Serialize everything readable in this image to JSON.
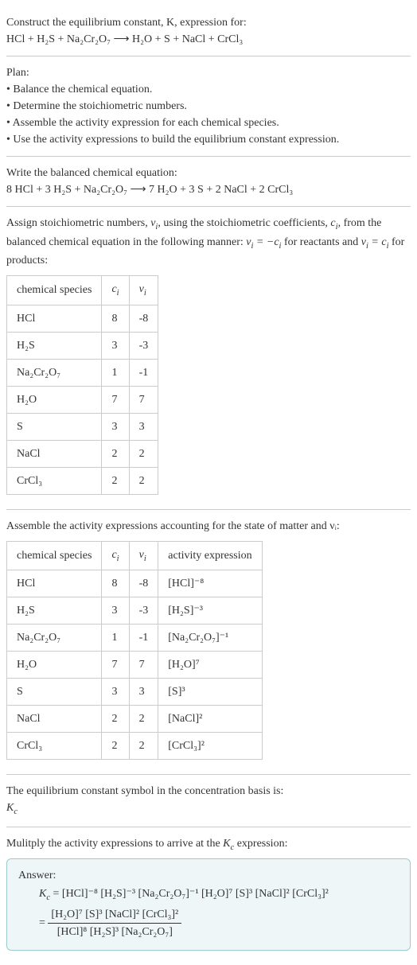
{
  "s1": {
    "l1": "Construct the equilibrium constant, K, expression for:",
    "l2": "HCl + H₂S + Na₂Cr₂O₇ ⟶ H₂O + S + NaCl + CrCl₃"
  },
  "s2": {
    "h": "Plan:",
    "b1": "• Balance the chemical equation.",
    "b2": "• Determine the stoichiometric numbers.",
    "b3": "• Assemble the activity expression for each chemical species.",
    "b4": "• Use the activity expressions to build the equilibrium constant expression."
  },
  "s3": {
    "l1": "Write the balanced chemical equation:",
    "l2": "8 HCl + 3 H₂S + Na₂Cr₂O₇ ⟶ 7 H₂O + 3 S + 2 NaCl + 2 CrCl₃"
  },
  "s4": {
    "p1a": "Assign stoichiometric numbers, ",
    "p1b": ", using the stoichiometric coefficients, ",
    "p1c": ", from the balanced chemical equation in the following manner: ",
    "p1d": " for reactants and ",
    "p1e": " for products:",
    "th1": "chemical species",
    "th2": "cᵢ",
    "th3": "νᵢ",
    "rows": [
      {
        "sp": "HCl",
        "c": "8",
        "v": "-8"
      },
      {
        "sp": "H₂S",
        "c": "3",
        "v": "-3"
      },
      {
        "sp": "Na₂Cr₂O₇",
        "c": "1",
        "v": "-1"
      },
      {
        "sp": "H₂O",
        "c": "7",
        "v": "7"
      },
      {
        "sp": "S",
        "c": "3",
        "v": "3"
      },
      {
        "sp": "NaCl",
        "c": "2",
        "v": "2"
      },
      {
        "sp": "CrCl₃",
        "c": "2",
        "v": "2"
      }
    ]
  },
  "s5": {
    "p1": "Assemble the activity expressions accounting for the state of matter and νᵢ:",
    "th1": "chemical species",
    "th2": "cᵢ",
    "th3": "νᵢ",
    "th4": "activity expression",
    "rows": [
      {
        "sp": "HCl",
        "c": "8",
        "v": "-8",
        "a": "[HCl]⁻⁸"
      },
      {
        "sp": "H₂S",
        "c": "3",
        "v": "-3",
        "a": "[H₂S]⁻³"
      },
      {
        "sp": "Na₂Cr₂O₇",
        "c": "1",
        "v": "-1",
        "a": "[Na₂Cr₂O₇]⁻¹"
      },
      {
        "sp": "H₂O",
        "c": "7",
        "v": "7",
        "a": "[H₂O]⁷"
      },
      {
        "sp": "S",
        "c": "3",
        "v": "3",
        "a": "[S]³"
      },
      {
        "sp": "NaCl",
        "c": "2",
        "v": "2",
        "a": "[NaCl]²"
      },
      {
        "sp": "CrCl₃",
        "c": "2",
        "v": "2",
        "a": "[CrCl₃]²"
      }
    ]
  },
  "s6": {
    "l1": "The equilibrium constant symbol in the concentration basis is:",
    "l2": "K",
    "l2sub": "c"
  },
  "s7": {
    "l1": "Mulitply the activity expressions to arrive at the ",
    "l1b": " expression:"
  },
  "ans": {
    "h": "Answer:",
    "line1": " = [HCl]⁻⁸ [H₂S]⁻³ [Na₂Cr₂O₇]⁻¹ [H₂O]⁷ [S]³ [NaCl]² [CrCl₃]²",
    "eq": "= ",
    "num": "[H₂O]⁷ [S]³ [NaCl]² [CrCl₃]²",
    "den": "[HCl]⁸ [H₂S]³ [Na₂Cr₂O₇]"
  },
  "chart_data": {
    "type": "table",
    "tables": [
      {
        "title": "Stoichiometric numbers",
        "columns": [
          "chemical species",
          "cᵢ",
          "νᵢ"
        ],
        "rows": [
          [
            "HCl",
            8,
            -8
          ],
          [
            "H₂S",
            3,
            -3
          ],
          [
            "Na₂Cr₂O₇",
            1,
            -1
          ],
          [
            "H₂O",
            7,
            7
          ],
          [
            "S",
            3,
            3
          ],
          [
            "NaCl",
            2,
            2
          ],
          [
            "CrCl₃",
            2,
            2
          ]
        ]
      },
      {
        "title": "Activity expressions",
        "columns": [
          "chemical species",
          "cᵢ",
          "νᵢ",
          "activity expression"
        ],
        "rows": [
          [
            "HCl",
            8,
            -8,
            "[HCl]^-8"
          ],
          [
            "H₂S",
            3,
            -3,
            "[H₂S]^-3"
          ],
          [
            "Na₂Cr₂O₇",
            1,
            -1,
            "[Na₂Cr₂O₇]^-1"
          ],
          [
            "H₂O",
            7,
            7,
            "[H₂O]^7"
          ],
          [
            "S",
            3,
            3,
            "[S]^3"
          ],
          [
            "NaCl",
            2,
            2,
            "[NaCl]^2"
          ],
          [
            "CrCl₃",
            2,
            2,
            "[CrCl₃]^2"
          ]
        ]
      }
    ]
  }
}
